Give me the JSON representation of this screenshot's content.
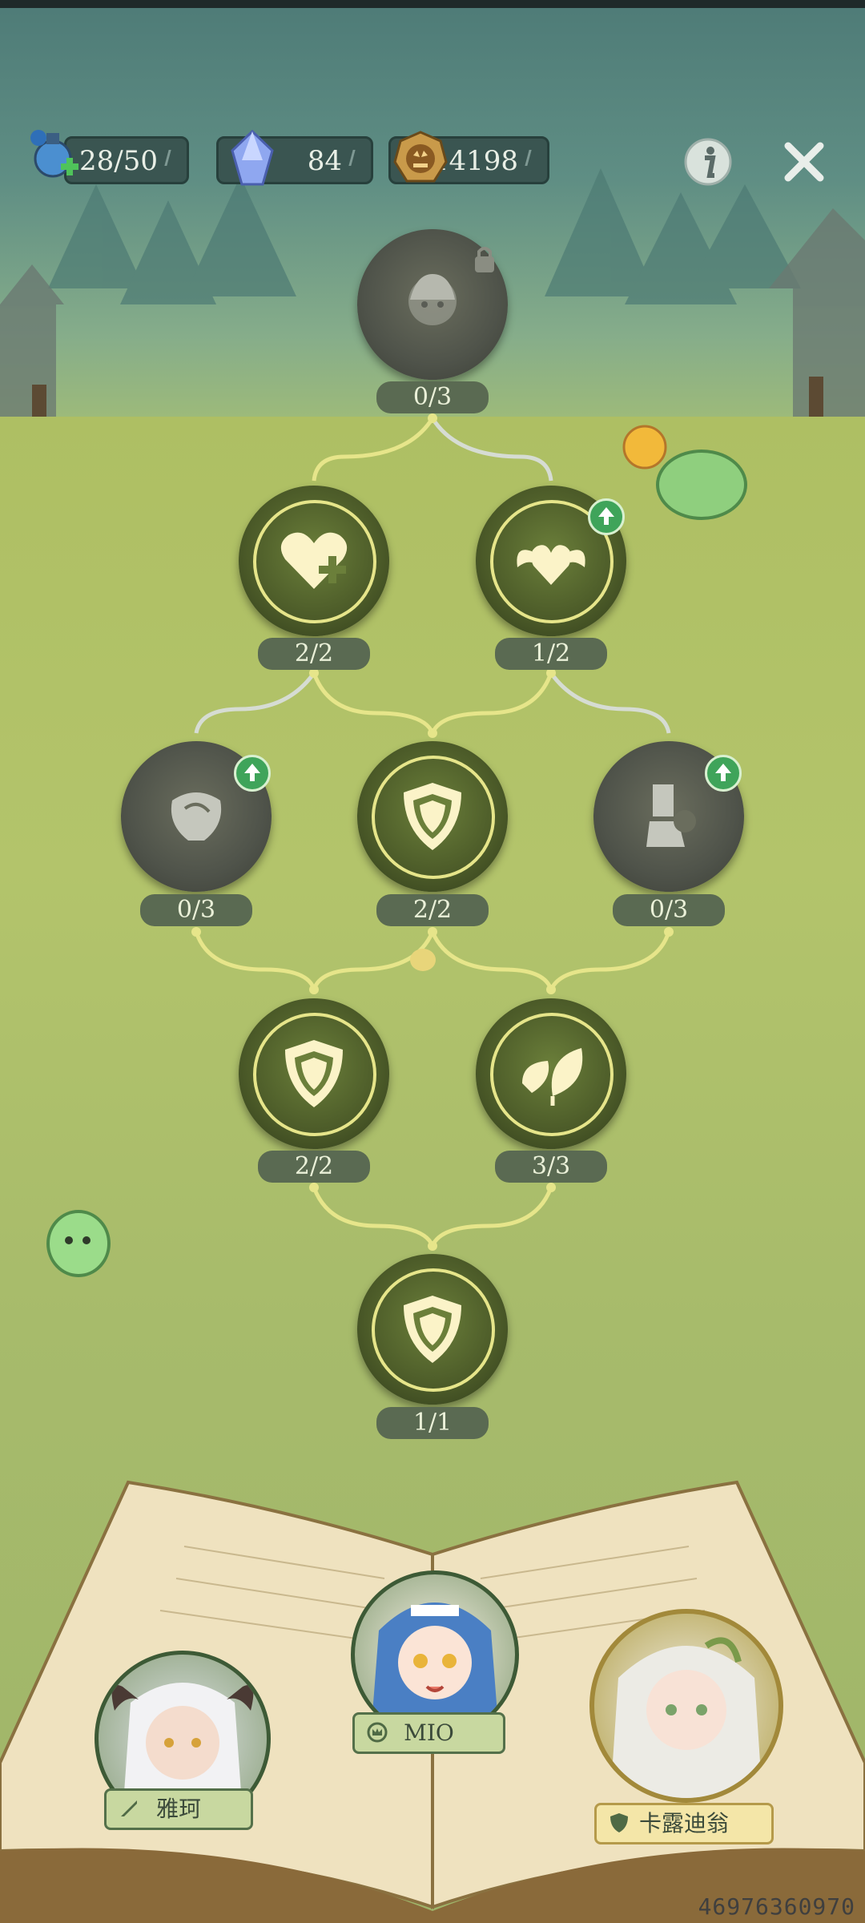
{
  "resources": {
    "stamina": "28/50",
    "crystals": "84",
    "coins": "14198"
  },
  "tree": {
    "top": {
      "count": "0/3",
      "state": "locked"
    },
    "row1": [
      {
        "count": "2/2",
        "icon": "heart-plus-icon",
        "upgrade": false
      },
      {
        "count": "1/2",
        "icon": "winged-heart-icon",
        "upgrade": true
      }
    ],
    "row2": [
      {
        "count": "0/3",
        "icon": "rose-icon",
        "upgrade": true,
        "locked": true
      },
      {
        "count": "2/2",
        "icon": "shield-icon",
        "upgrade": false
      },
      {
        "count": "0/3",
        "icon": "broken-pillar-icon",
        "upgrade": true,
        "locked": true
      }
    ],
    "row3": [
      {
        "count": "2/2",
        "icon": "shield-icon",
        "upgrade": false
      },
      {
        "count": "3/3",
        "icon": "leaf-icon",
        "upgrade": false
      }
    ],
    "bottom": {
      "count": "1/1",
      "icon": "shield-icon"
    }
  },
  "team": {
    "left": {
      "name": "雅珂",
      "role": "sword-icon"
    },
    "center": {
      "name": "MIO",
      "role": "crown-icon"
    },
    "right": {
      "name": "卡露迪翁",
      "role": "shield-icon"
    }
  },
  "footer_id": "46976360970",
  "colors": {
    "accent_ring": "#e6e58a",
    "node_fill": "#4b5a28",
    "upgrade_badge": "#3fa45a"
  }
}
